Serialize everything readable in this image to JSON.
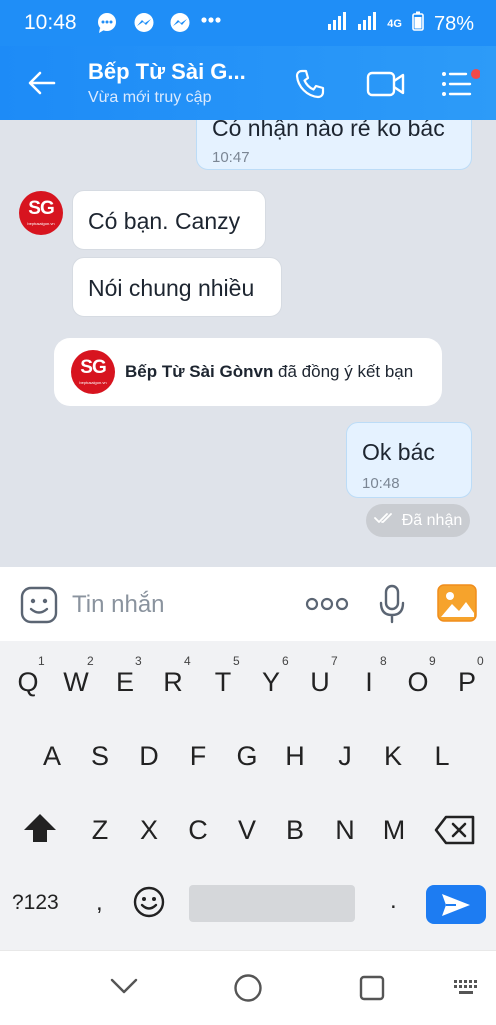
{
  "status_bar": {
    "time": "10:48",
    "network": "4G",
    "battery": "78%"
  },
  "header": {
    "title": "Bếp Từ Sài G...",
    "subtitle": "Vừa mới truy cập"
  },
  "messages": {
    "m1": {
      "text": "Có nhận nào rẻ ko bác",
      "time": "10:47"
    },
    "m2": {
      "text": "Có bạn. Canzy"
    },
    "m3": {
      "text": "Nói chung nhiều"
    },
    "m4": {
      "text": "Ok bác",
      "time": "10:48"
    }
  },
  "system_message": {
    "name": "Bếp Từ Sài Gònvn",
    "text": " đã đồng ý kết bạn"
  },
  "avatar": {
    "initials": "SG",
    "site": "beptusaigon.vn"
  },
  "delivery_status": "Đã nhận",
  "input": {
    "placeholder": "Tin nhắn"
  },
  "keyboard": {
    "row1": [
      "Q",
      "W",
      "E",
      "R",
      "T",
      "Y",
      "U",
      "I",
      "O",
      "P"
    ],
    "row1_numbers": [
      "1",
      "2",
      "3",
      "4",
      "5",
      "6",
      "7",
      "8",
      "9",
      "0"
    ],
    "row2": [
      "A",
      "S",
      "D",
      "F",
      "G",
      "H",
      "J",
      "K",
      "L"
    ],
    "row3": [
      "Z",
      "X",
      "C",
      "V",
      "B",
      "N",
      "M"
    ],
    "symbols_key": "?123",
    "comma_key": ",",
    "period_key": "."
  },
  "colors": {
    "primary": "#1f8ef7",
    "chat_bg": "#dfe3ea",
    "own_bubble": "#e5f2ff",
    "avatar_red": "#d7141f",
    "send_blue": "#1d7cf2"
  }
}
